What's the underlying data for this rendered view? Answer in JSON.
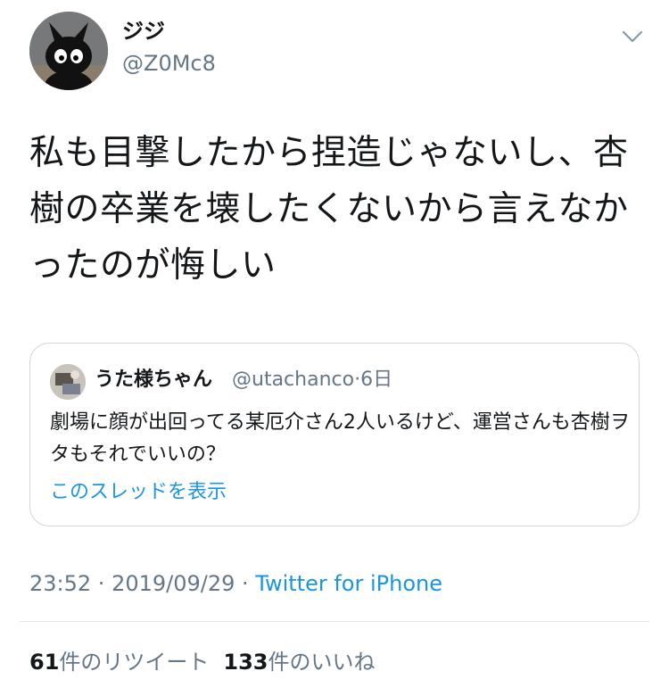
{
  "author": {
    "display_name": "ジジ",
    "handle": "@Z0Mc8",
    "avatar_icon": "black-cat-avatar-icon"
  },
  "menu_icon": "chevron-down-icon",
  "tweet": {
    "text": "私も目撃したから捏造じゃないし、杏樹の卒業を壊したくないから言えなかったのが悔しい"
  },
  "quote": {
    "display_name": "うた様ちゃん",
    "handle": "@utachanco",
    "time": "·6日",
    "text": "劇場に顔が出回ってる某厄介さん2人いるけど、運営さんも杏樹ヲタもそれでいいの？",
    "link": "このスレッドを表示"
  },
  "meta": {
    "time": "23:52",
    "sep1": " · ",
    "date": "2019/09/29",
    "sep2": " · ",
    "source": "Twitter for iPhone"
  },
  "stats": {
    "retweet_count": "61",
    "retweet_label": "件のリツイート",
    "like_count": "133",
    "like_label": "件のいいね"
  },
  "colors": {
    "accent": "#1b95e0",
    "secondary_text": "#657786",
    "border": "#ccd6dd"
  }
}
